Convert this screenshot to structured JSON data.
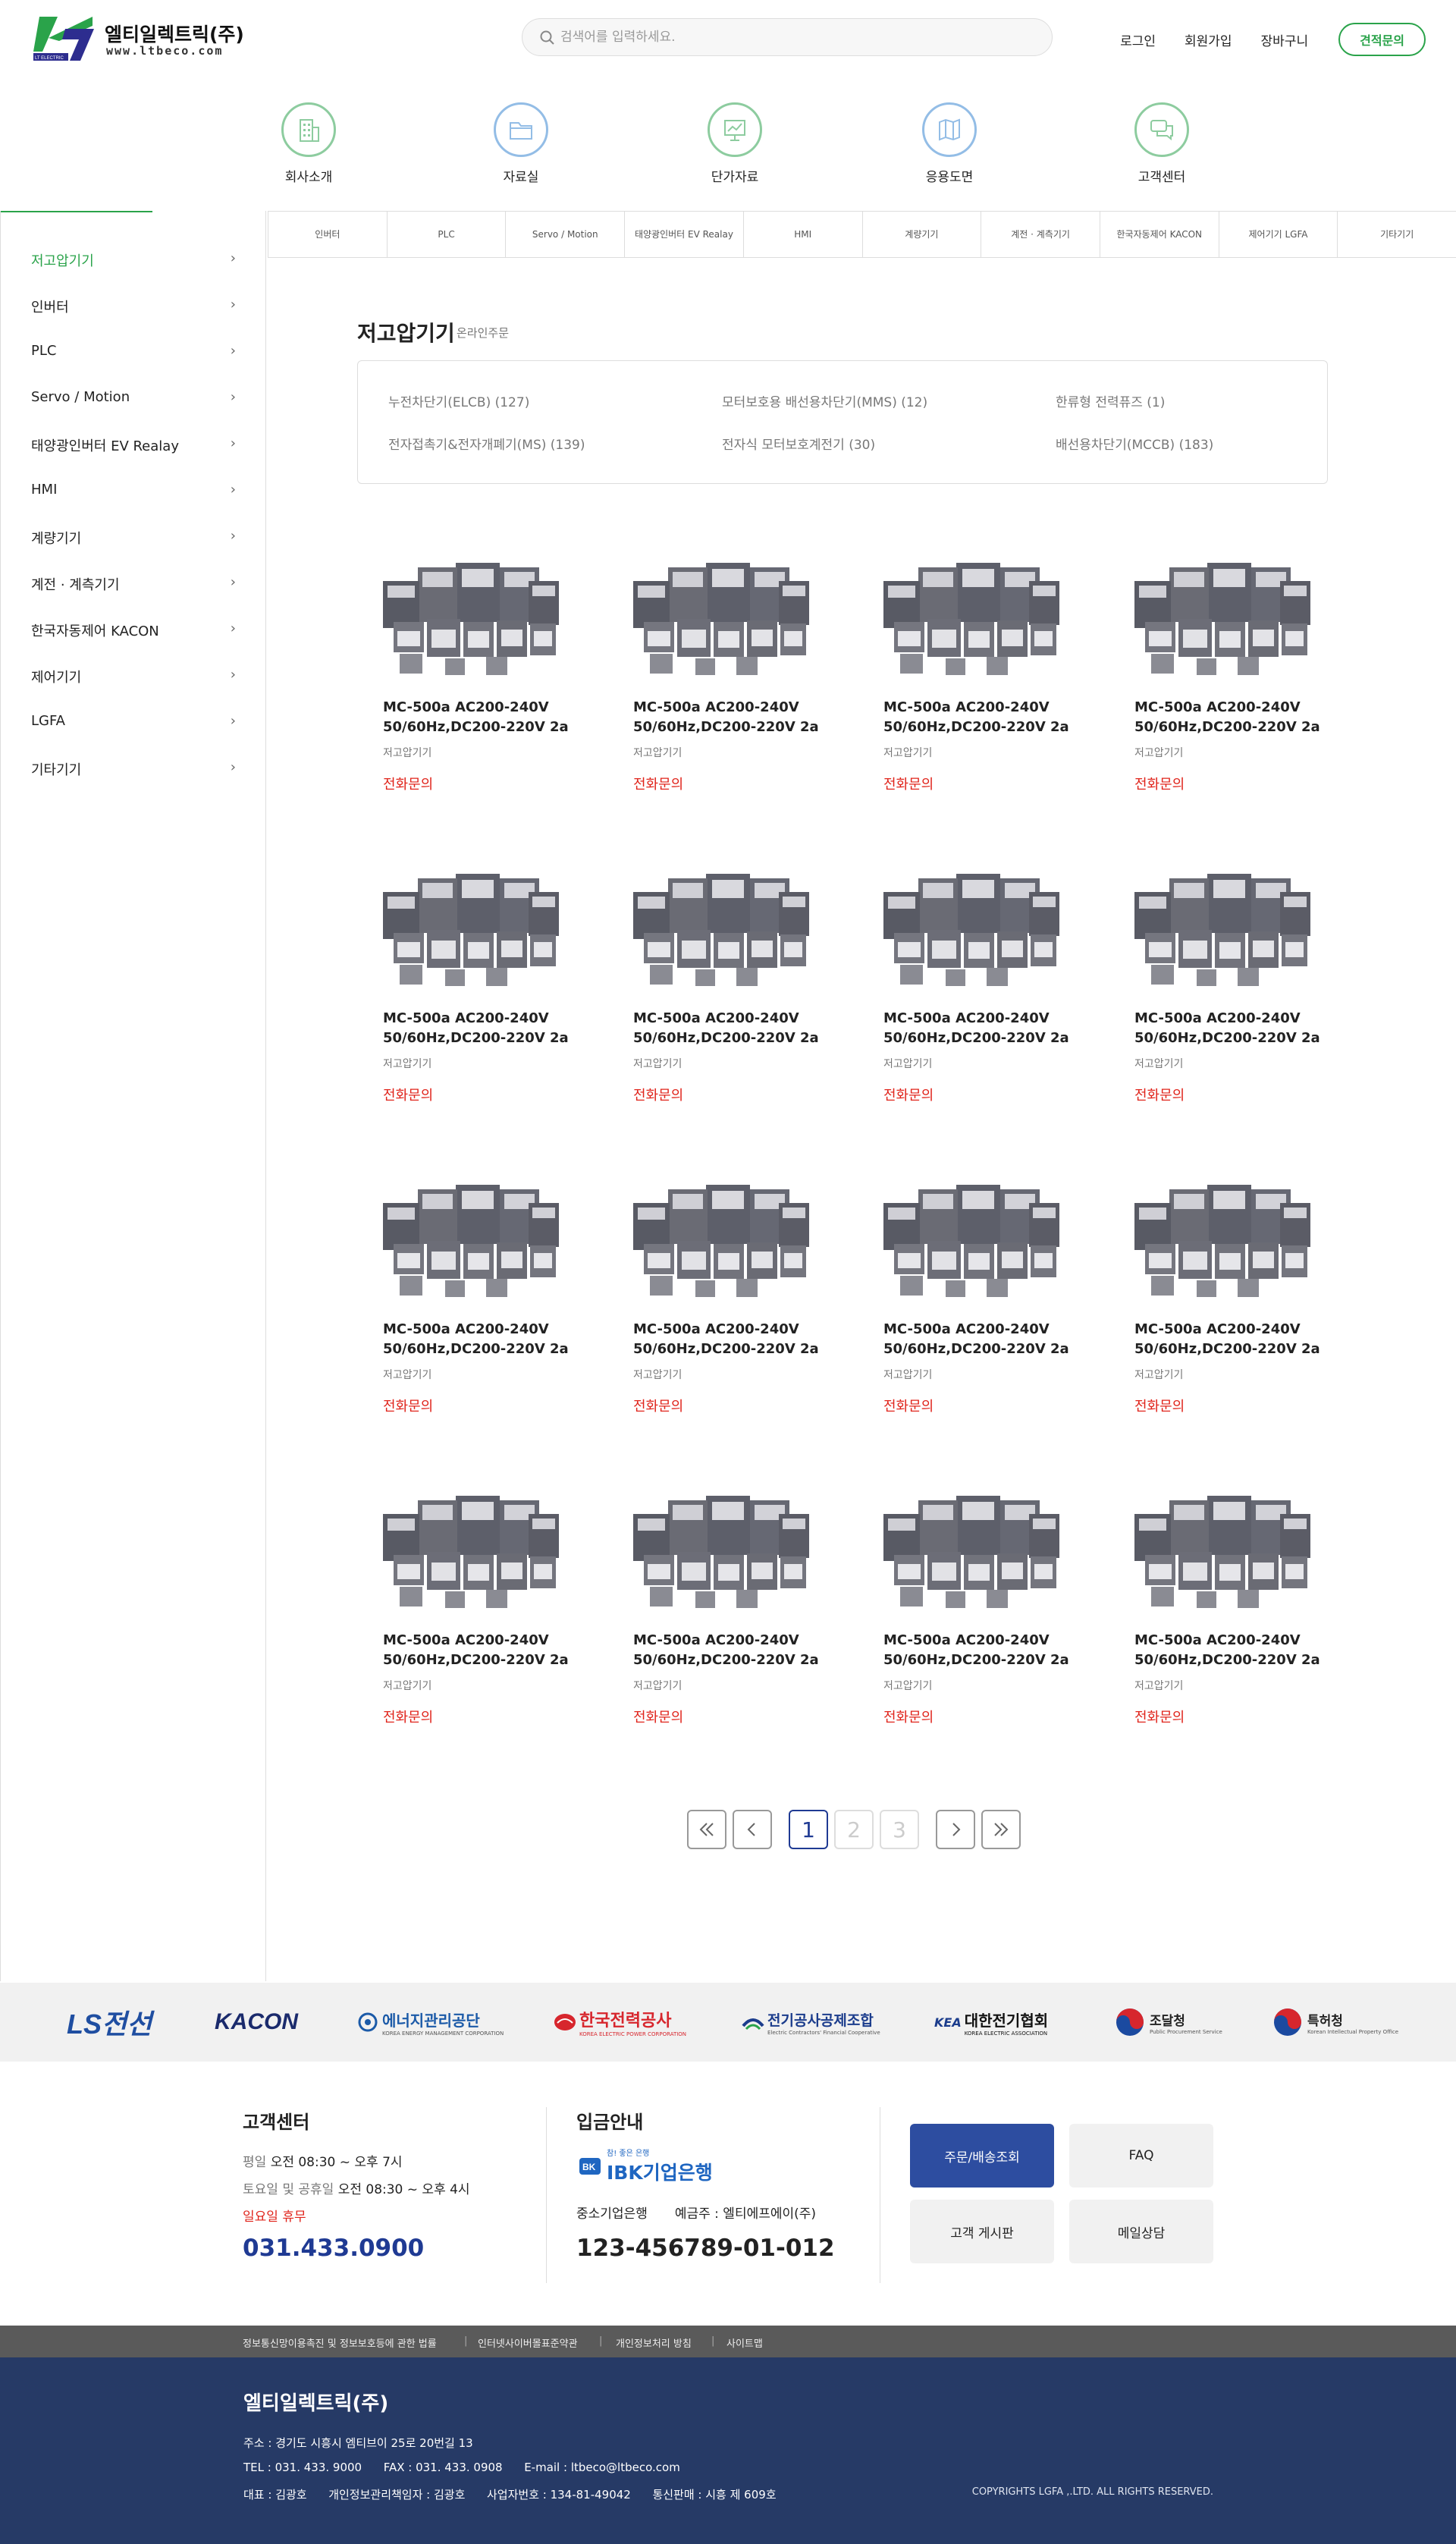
{
  "brand": {
    "name": "엘티일렉트릭(주)",
    "url": "www.ltbeco.com",
    "mark_text": "LT ELECTRIC"
  },
  "search": {
    "placeholder": "검색어를 입력하세요."
  },
  "toplinks": [
    "로그인",
    "회원가입",
    "장바구니"
  ],
  "quote_button": "견적문의",
  "icon_nav": [
    {
      "label": "회사소개",
      "icon": "building-icon",
      "color": "#6fbe83"
    },
    {
      "label": "자료실",
      "icon": "folder-icon",
      "color": "#7fb0e0"
    },
    {
      "label": "단가자료",
      "icon": "chart-board-icon",
      "color": "#6fbe83"
    },
    {
      "label": "응용도면",
      "icon": "map-icon",
      "color": "#7fb0e0"
    },
    {
      "label": "고객센터",
      "icon": "chat-icon",
      "color": "#6fbe83"
    }
  ],
  "category_bar": [
    "인버터",
    "PLC",
    "Servo / Motion",
    "태양광인버터 EV Realay",
    "HMI",
    "계량기기",
    "계전 · 계측기기",
    "한국자동제어 KACON",
    "제어기기 LGFA",
    "기타기기"
  ],
  "sidebar": [
    "저고압기기",
    "인버터",
    "PLC",
    "Servo / Motion",
    "태양광인버터 EV Realay",
    "HMI",
    "계량기기",
    "계전 · 계측기기",
    "한국자동제어 KACON",
    "제어기기",
    "LGFA",
    "기타기기"
  ],
  "section": {
    "title": "저고압기기",
    "subtitle": "온라인주문"
  },
  "filters": [
    "누전차단기(ELCB) (127)",
    "모터보호용 배선용차단기(MMS) (12)",
    "한류형 전력퓨즈 (1)",
    "전자접촉기&전자개폐기(MS) (139)",
    "전자식 모터보호계전기 (30)",
    "배선용차단기(MCCB) (183)"
  ],
  "product": {
    "name": "MC-500a AC200-240V 50/60Hz,DC200-220V 2a",
    "category": "저고압기기",
    "price": "전화문의"
  },
  "pagination": {
    "pages": [
      "1",
      "2",
      "3"
    ],
    "current": "1"
  },
  "partners": [
    "LS전선",
    "KACON",
    "에너지관리공단",
    "한국전력공사",
    "전기공사공제조합",
    "대한전기협회",
    "조달청",
    "특허청"
  ],
  "partner_subs": {
    "energy": "KOREA ENERGY MANAGEMENT CORPORATION",
    "kepco": "KOREA ELECTRIC POWER CORPORATION",
    "eccc": "Electric Contractors' Financial Cooperative",
    "kea": "KOREA ELECTRIC ASSOCIATION",
    "pps": "Public Procurement Service",
    "kipo": "Korean Intellectual Property Office"
  },
  "customer_center": {
    "title": "고객센터",
    "weekday_label": "평일",
    "weekday_time": "오전 08:30 ~ 오후 7시",
    "sat_label": "토요일 및 공휴일",
    "sat_time": "오전 08:30 ~ 오후 4시",
    "closed": "일요일 휴무",
    "phone": "031.433.0900"
  },
  "deposit": {
    "title": "입금안내",
    "bank_tagline": "참! 좋은 은행",
    "bank_name": "IBK기업은행",
    "bank_label": "중소기업은행",
    "holder": "예금주 : 엘티에프에이(주)",
    "account": "123-456789-01-012"
  },
  "tiles": [
    "주문/배송조회",
    "FAQ",
    "고객 게시판",
    "메일상담"
  ],
  "policy_links": [
    "정보통신망이용촉진 및 정보보호등에 관한 법률",
    "인터넷사이버몰표준약관",
    "개인정보처리 방침",
    "사이트맵"
  ],
  "footer": {
    "company": "엘티일렉트릭(주)",
    "address": "주소 : 경기도 시흥시 엠티브이 25로 20번길 13",
    "contact": "TEL : 031. 433. 9000      FAX : 031. 433. 0908      E-mail : ltbeco@ltbeco.com",
    "biz": "대표 : 김광호      개인정보관리책임자 : 김광호      사업자번호 : 134-81-49042      통신판매 : 시흥 제 609호",
    "copyright": "COPYRIGHTS LGFA ,.LTD. ALL RIGHTS RESERVED."
  },
  "colors": {
    "green": "#2aa34a",
    "navy": "#263a66",
    "price": "#e0241b",
    "tile": "#2d4da0"
  }
}
